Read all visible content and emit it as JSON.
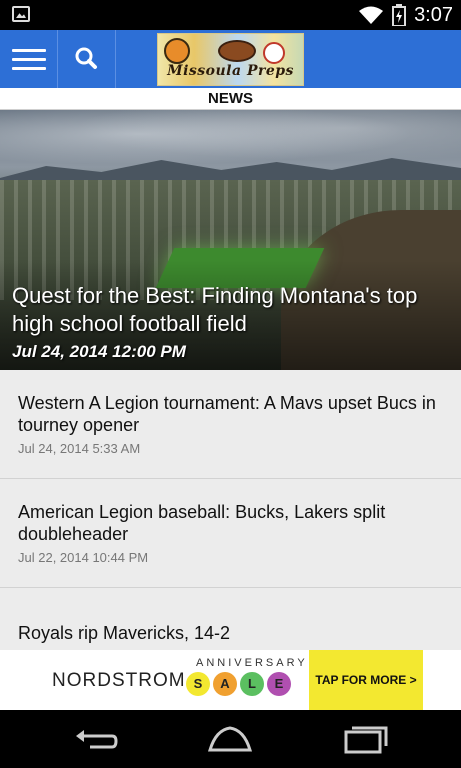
{
  "status_bar": {
    "time": "3:07",
    "icons": [
      "image-notification-icon",
      "wifi-icon",
      "battery-charging-icon"
    ]
  },
  "app_bar": {
    "menu_icon": "hamburger-menu-icon",
    "search_icon": "search-icon",
    "logo_text": "Missoula Preps",
    "accent_color": "#2d6fd6"
  },
  "section": {
    "title": "NEWS"
  },
  "featured": {
    "title": "Quest for the Best: Finding Montana's top high school football field",
    "date": "Jul 24, 2014 12:00 PM"
  },
  "articles": [
    {
      "title": "Western A Legion tournament: A Mavs upset Bucs in tourney opener",
      "date": "Jul 24, 2014 5:33 AM"
    },
    {
      "title": "American Legion baseball: Bucks, Lakers split doubleheader",
      "date": "Jul 22, 2014 10:44 PM"
    },
    {
      "title": "Royals rip Mavericks, 14-2",
      "date": ""
    }
  ],
  "ad": {
    "brand": "NORDSTROM",
    "anniversary": "ANNIVERSARY",
    "sale_letters": [
      "S",
      "A",
      "L",
      "E"
    ],
    "sale_colors": [
      "#f3e830",
      "#f0a030",
      "#5bbf60",
      "#b04fb0"
    ],
    "cta": "TAP FOR MORE >",
    "cta_color": "#f3e830"
  },
  "nav_bar": {
    "icons": [
      "back-icon",
      "home-icon",
      "recent-apps-icon"
    ]
  }
}
